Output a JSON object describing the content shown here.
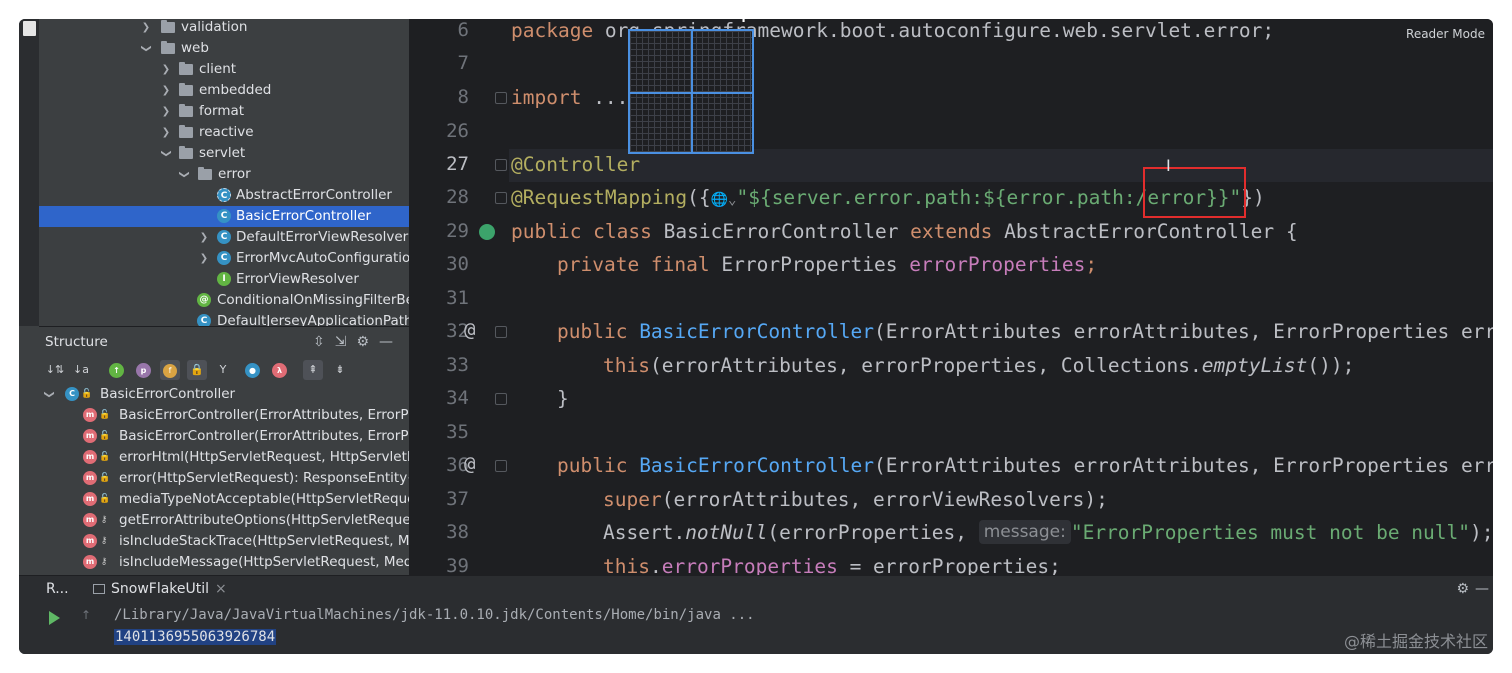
{
  "project_tree": {
    "items": [
      {
        "label": "validation",
        "kind": "folder",
        "level": 1,
        "expanded": false
      },
      {
        "label": "web",
        "kind": "folder",
        "level": 1,
        "expanded": true
      },
      {
        "label": "client",
        "kind": "folder",
        "level": 2,
        "expanded": false
      },
      {
        "label": "embedded",
        "kind": "folder",
        "level": 2,
        "expanded": false
      },
      {
        "label": "format",
        "kind": "folder",
        "level": 2,
        "expanded": false
      },
      {
        "label": "reactive",
        "kind": "folder",
        "level": 2,
        "expanded": false
      },
      {
        "label": "servlet",
        "kind": "folder",
        "level": 2,
        "expanded": true
      },
      {
        "label": "error",
        "kind": "folder",
        "level": 3,
        "expanded": true
      },
      {
        "label": "AbstractErrorController",
        "kind": "abstract-class",
        "level": 4
      },
      {
        "label": "BasicErrorController",
        "kind": "class",
        "level": 4,
        "selected": true
      },
      {
        "label": "DefaultErrorViewResolver",
        "kind": "class",
        "level": 4,
        "expandable": true
      },
      {
        "label": "ErrorMvcAutoConfiguration",
        "kind": "class",
        "level": 4,
        "expandable": true
      },
      {
        "label": "ErrorViewResolver",
        "kind": "interface",
        "level": 4
      },
      {
        "label": "ConditionalOnMissingFilterBean",
        "kind": "annotation",
        "level": 3
      },
      {
        "label": "DefaultJerseyApplicationPath",
        "kind": "class",
        "level": 3
      }
    ]
  },
  "structure": {
    "title": "Structure",
    "root": "BasicErrorController",
    "members": [
      "BasicErrorController(ErrorAttributes, ErrorPro",
      "BasicErrorController(ErrorAttributes, ErrorPro",
      "errorHtml(HttpServletRequest, HttpServletRe",
      "error(HttpServletRequest): ResponseEntity<",
      "mediaTypeNotAcceptable(HttpServletReques",
      "getErrorAttributeOptions(HttpServletReques",
      "isIncludeStackTrace(HttpServletRequest, Me",
      "isIncludeMessage(HttpServletRequest, Medi"
    ],
    "member_visibility": [
      "public",
      "public",
      "public",
      "public",
      "public",
      "protected",
      "protected",
      "protected"
    ]
  },
  "editor": {
    "reader_mode_label": "Reader Mode",
    "line_numbers": [
      "6",
      "7",
      "8",
      "26",
      "27",
      "28",
      "29",
      "30",
      "31",
      "32",
      "33",
      "34",
      "35",
      "36",
      "37",
      "38",
      "39"
    ],
    "lines": {
      "l6_kw": "package",
      "l6_rest": " org.springframework.boot.autoconfigure.web.servlet.error;",
      "l8_kw": "import",
      "l8_rest": " ...",
      "l27": "@Controller",
      "l28_ann": "@RequestMapping",
      "l28_open": "({",
      "l28_globe": "🌐⌄",
      "l28_str1": "\"${server.error.path:${error.path",
      "l28_str2": ":/error}}\"",
      "l28_close": "})",
      "l29_kw": "public class",
      "l29_name": " BasicErrorController ",
      "l29_kw2": "extends",
      "l29_rest": " AbstractErrorController {",
      "l30_kw": "private final",
      "l30_type": " ErrorProperties ",
      "l30_fld": "errorProperties",
      "l30_end": ";",
      "l32_kw": "public",
      "l32_fn": " BasicErrorController",
      "l32_rest": "(ErrorAttributes errorAttributes, ErrorProperties error",
      "l33_kw": "this",
      "l33_rest": "(errorAttributes, errorProperties, Collections.",
      "l33_it": "emptyList",
      "l33_end": "());",
      "l34": "}",
      "l36_kw": "public",
      "l36_fn": " BasicErrorController",
      "l36_rest": "(ErrorAttributes errorAttributes, ErrorProperties error",
      "l37_kw": "super",
      "l37_rest": "(errorAttributes, errorViewResolvers);",
      "l38_pre": "Assert.",
      "l38_it": "notNull",
      "l38_mid": "(errorProperties, ",
      "l38_hint": "message:",
      "l38_str": "\"ErrorProperties must not be null\"",
      "l38_end": ");",
      "l39_kw": "this",
      "l39_dot": ".",
      "l39_fld": "errorProperties",
      "l39_rest": " = errorProperties;"
    }
  },
  "run_panel": {
    "short_label": "R...",
    "tab_label": "SnowFlakeUtil",
    "tab_close": "×",
    "command": "/Library/Java/JavaVirtualMachines/jdk-11.0.10.jdk/Contents/Home/bin/java ...",
    "output": "1401136955063926784"
  },
  "watermark": "@稀土掘金技术社区",
  "colors": {
    "keyword": "#cf8e6d",
    "annotation": "#b3ae60",
    "string": "#6aab73",
    "method": "#56a8f5",
    "field": "#c77dbb",
    "selection": "#2f65ca",
    "highlight_box": "#e22d2d"
  }
}
